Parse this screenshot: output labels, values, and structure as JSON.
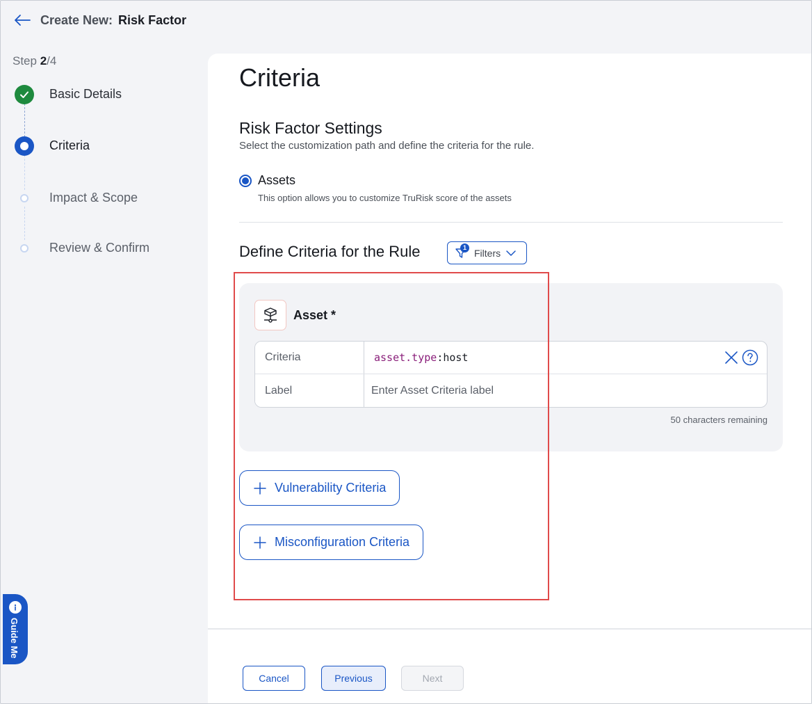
{
  "header": {
    "prefix": "Create New:",
    "title": "Risk Factor"
  },
  "stepper": {
    "step_word": "Step ",
    "current": "2",
    "total": "/4",
    "steps": [
      {
        "label": "Basic Details",
        "state": "done"
      },
      {
        "label": "Criteria",
        "state": "current"
      },
      {
        "label": "Impact & Scope",
        "state": "future"
      },
      {
        "label": "Review & Confirm",
        "state": "future"
      }
    ]
  },
  "main": {
    "page_title": "Criteria",
    "section_title": "Risk Factor Settings",
    "section_subtitle": "Select the customization path and define the criteria for the rule.",
    "radio_option": {
      "label": "Assets",
      "help": "This option allows you to customize TruRisk score of the assets",
      "selected": true
    },
    "define_title": "Define Criteria for the Rule",
    "filters": {
      "label": "Filters",
      "count": "1"
    },
    "asset_panel": {
      "title": "Asset *",
      "criteria_key": "Criteria",
      "criteria_value_part1": "asset.type",
      "criteria_value_part2": ":host",
      "label_key": "Label",
      "label_placeholder": "Enter Asset Criteria label",
      "chars_remaining": "50 characters remaining"
    },
    "add_buttons": {
      "vulnerability": "Vulnerability Criteria",
      "misconfiguration": "Misconfiguration Criteria"
    }
  },
  "footer": {
    "cancel": "Cancel",
    "previous": "Previous",
    "next": "Next"
  },
  "guide_me": {
    "label": "Guide Me"
  },
  "colors": {
    "accent": "#1a56c5",
    "success": "#1e8a3e",
    "highlight": "#e04a4a"
  }
}
